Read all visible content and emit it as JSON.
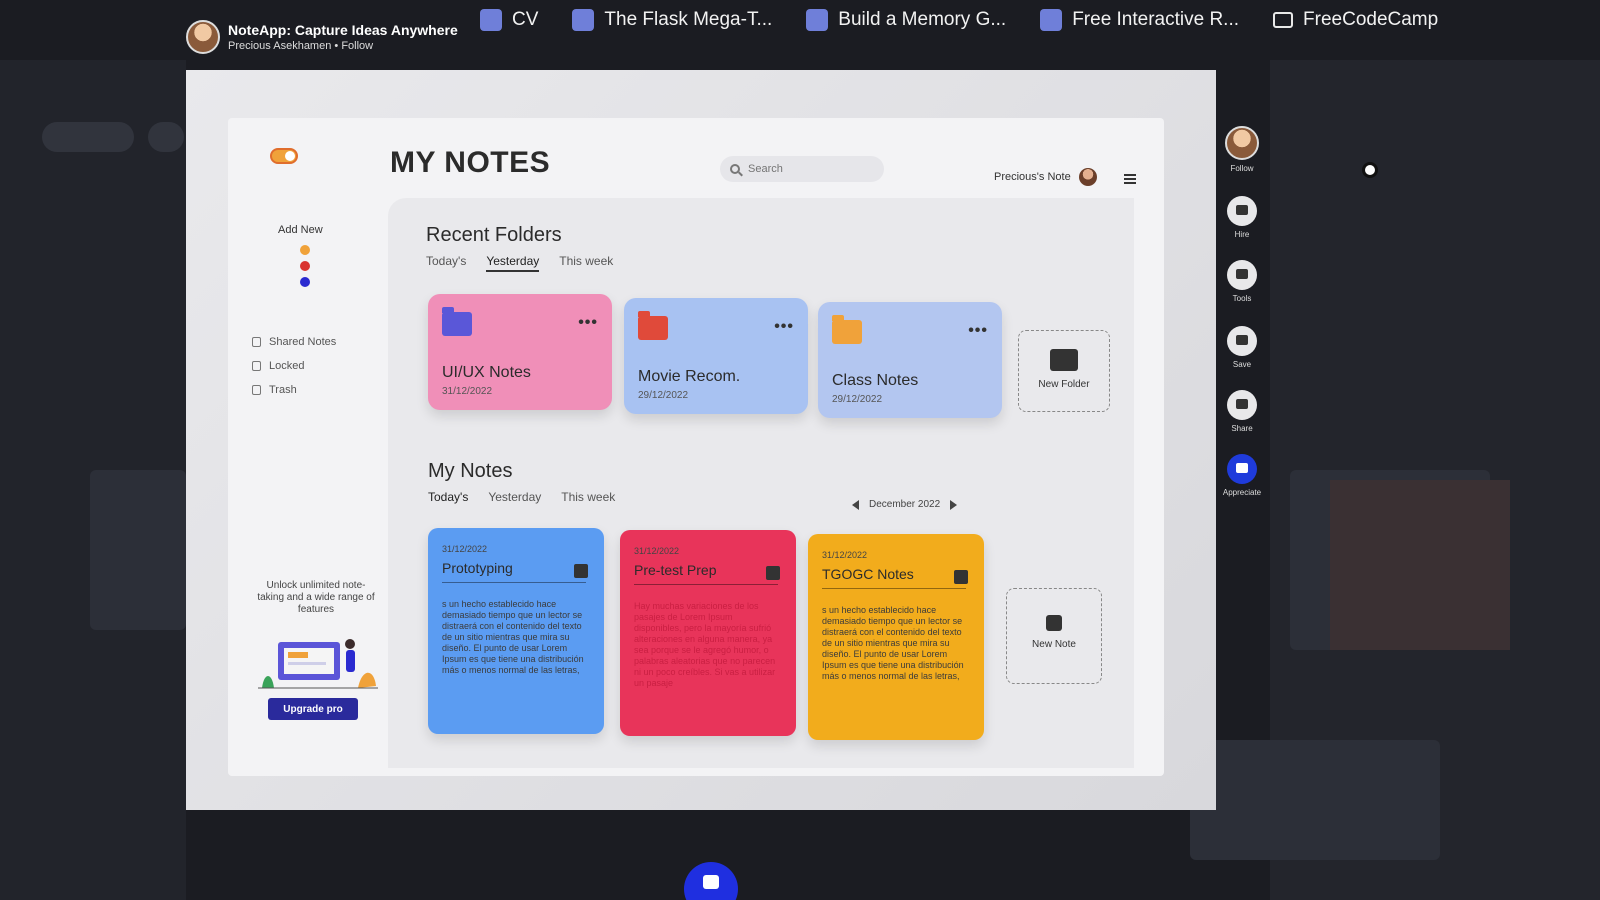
{
  "bookmarks": [
    {
      "label": "CV",
      "icon": "bookmark-icon"
    },
    {
      "label": "The Flask Mega-T...",
      "icon": "bookmark-icon"
    },
    {
      "label": "Build a Memory G...",
      "icon": "bookmark-icon"
    },
    {
      "label": "Free Interactive R...",
      "icon": "bookmark-icon"
    },
    {
      "label": "FreeCodeCamp",
      "icon": "folder-icon"
    }
  ],
  "project": {
    "title": "NoteApp: Capture Ideas Anywhere",
    "author": "Precious Asekhamen",
    "follow": "Follow"
  },
  "app": {
    "title": "MY NOTES",
    "search_placeholder": "Search",
    "user_name": "Precious's Note",
    "sidebar": {
      "add_new": "Add New",
      "colors": [
        "#f0a23a",
        "#d9332f",
        "#2a2ad0"
      ],
      "items": [
        {
          "label": "Shared Notes"
        },
        {
          "label": "Locked"
        },
        {
          "label": "Trash"
        }
      ],
      "upsell_text": "Unlock unlimited note-taking and a wide range of features",
      "upgrade_label": "Upgrade pro"
    },
    "recent_folders": {
      "title": "Recent Folders",
      "tabs": [
        "Today's",
        "Yesterday",
        "This week"
      ],
      "active_tab": "Yesterday",
      "folders": [
        {
          "name": "UI/UX Notes",
          "date": "31/12/2022",
          "bg": "#f08fb8",
          "icon_color": "#5a57d8"
        },
        {
          "name": "Movie Recom.",
          "date": "29/12/2022",
          "bg": "#a8c2f2",
          "icon_color": "#e04a3a"
        },
        {
          "name": "Class Notes",
          "date": "29/12/2022",
          "bg": "#b3c6f0",
          "icon_color": "#f0a23a"
        }
      ],
      "new_label": "New Folder"
    },
    "my_notes": {
      "title": "My Notes",
      "tabs": [
        "Today's",
        "Yesterday",
        "This week"
      ],
      "month": "December 2022",
      "notes": [
        {
          "date": "31/12/2022",
          "title": "Prototyping",
          "bg": "#5b9cf2",
          "body": "s un hecho establecido hace demasiado tiempo que un lector se distraerá con el contenido del texto de un sitio mientras que mira su diseño. El punto de usar Lorem Ipsum es que tiene una distribución más o menos normal de las letras,"
        },
        {
          "date": "31/12/2022",
          "title": "Pre-test Prep",
          "bg": "#e8345a",
          "body": "Hay muchas variaciones de los pasajes de Lorem Ipsum disponibles, pero la mayoría sufrió alteraciones en alguna manera, ya sea porque se le agregó humor, o palabras aleatorias que no parecen ni un poco creíbles. Si vas a utilizar un pasaje"
        },
        {
          "date": "31/12/2022",
          "title": "TGOGC Notes",
          "bg": "#f2ac1c",
          "body": "s un hecho establecido hace demasiado tiempo que un lector se distraerá con el contenido del texto de un sitio mientras que mira su diseño. El punto de usar Lorem Ipsum es que tiene una distribución más o menos normal de las letras,"
        }
      ],
      "new_label": "New Note"
    }
  },
  "rail": [
    {
      "label": "Follow",
      "icon": "avatar"
    },
    {
      "label": "Hire",
      "icon": "mail-icon"
    },
    {
      "label": "Tools",
      "icon": "tools-icon"
    },
    {
      "label": "Save",
      "icon": "folder-icon"
    },
    {
      "label": "Share",
      "icon": "share-icon"
    },
    {
      "label": "Appreciate",
      "icon": "thumbs-up-icon"
    }
  ]
}
